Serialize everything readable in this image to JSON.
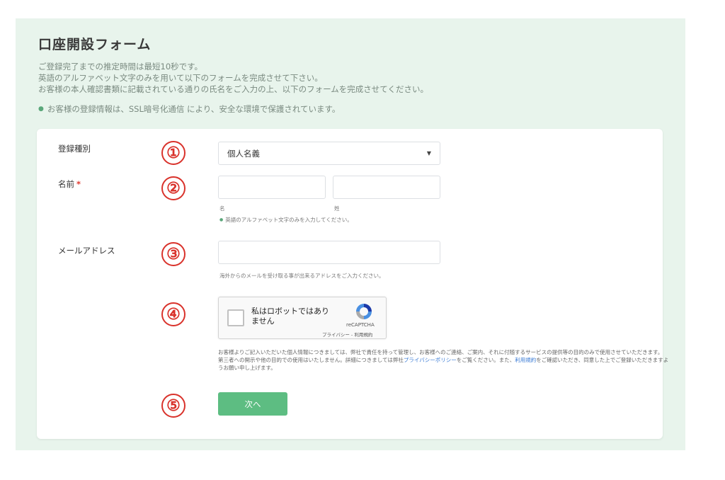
{
  "form": {
    "title": "口座開設フォーム",
    "intro_lines": [
      "ご登録完了までの推定時間は最短10秒です。",
      "英語のアルファベット文字のみを用いて以下のフォームを完成させて下さい。",
      "お客様の本人確認書類に記載されている通りの氏名をご入力の上、以下のフォームを完成させてください。"
    ],
    "ssl_note": "お客様の登録情報は、SSL暗号化通信 により、安全な環境で保護されています。"
  },
  "fields": {
    "registration_type": {
      "label": "登録種別",
      "value": "個人名義"
    },
    "name": {
      "label": "名前",
      "required_mark": "*",
      "first_caption": "名",
      "last_caption": "姓",
      "hint": "英語のアルファベット文字のみを入力してください。"
    },
    "email": {
      "label": "メールアドレス",
      "hint": "海外からのメールを受け取る事が出来るアドレスをご入力ください。"
    }
  },
  "markers": [
    "①",
    "②",
    "③",
    "④",
    "⑤"
  ],
  "captcha": {
    "label_line1": "私はロボットではあり",
    "label_line2": "ません",
    "brand": "reCAPTCHA",
    "links": "プライバシー - 利用規約"
  },
  "consent": {
    "line1": "お客様よりご記入いただいた個人情報につきましては、弊社で責任を持って管理し、お客様へのご連絡、ご案内、それに付随するサービスの提供等の目的のみで使用させていただきます。",
    "line2_a": "第三者への開示や他の目的での使用はいたしません。詳細につきましては弊社",
    "privacy_link": "プライバシーポリシー",
    "line2_b": "をご覧ください。また、",
    "terms_link": "利用規約",
    "line2_c": "をご確認いただき、同意した上でご登録いただきますようお願い申し上げます。"
  },
  "buttons": {
    "next": "次へ"
  },
  "colors": {
    "accent": "#5dbd82",
    "marker": "#d9322b",
    "panel_bg": "#e8f4ec",
    "link": "#3a7bd5"
  }
}
